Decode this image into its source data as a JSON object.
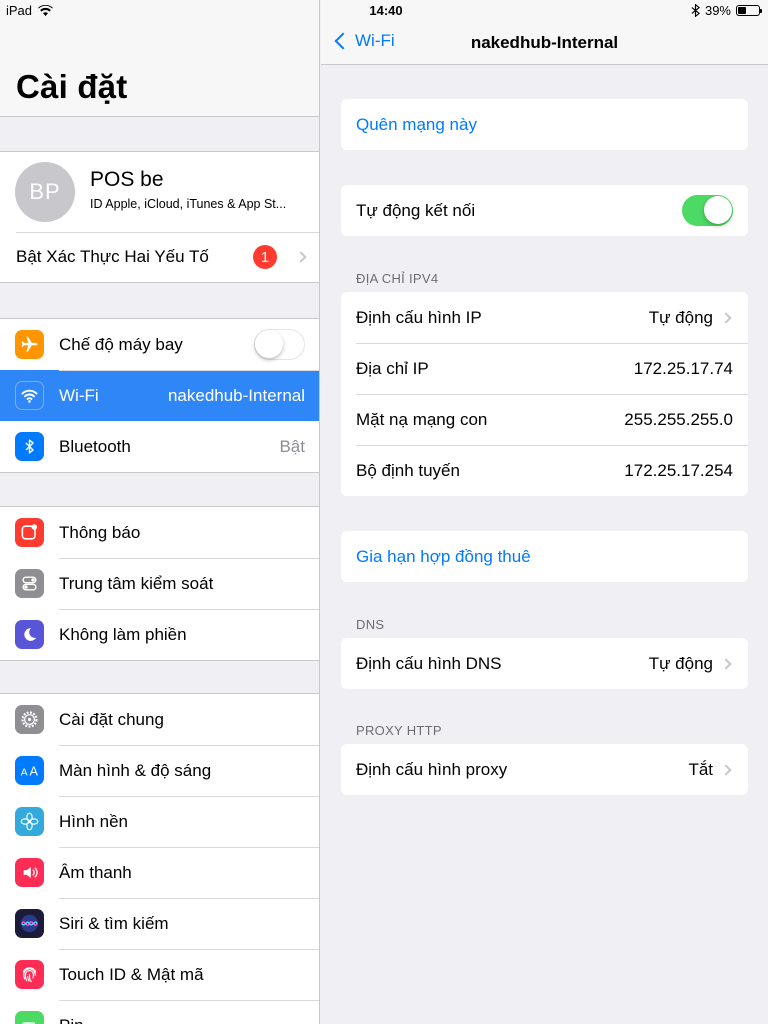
{
  "status_bar": {
    "device": "iPad",
    "time": "14:40",
    "battery": "39%",
    "battery_level": 0.39
  },
  "master": {
    "title": "Cài đặt",
    "profile": {
      "initials": "BP",
      "name": "POS be",
      "subtitle": "ID Apple, iCloud, iTunes & App St..."
    },
    "two_factor": {
      "label": "Bật Xác Thực Hai Yếu Tố",
      "badge": "1"
    },
    "connectivity": [
      {
        "label": "Chế độ máy bay",
        "icon": "airplane-icon",
        "color": "#ff9500",
        "toggle": false
      },
      {
        "label": "Wi-Fi",
        "value": "nakedhub-Internal",
        "icon": "wifi-icon",
        "color": "#007aff"
      },
      {
        "label": "Bluetooth",
        "value": "Bật",
        "icon": "bluetooth-icon",
        "color": "#007aff"
      }
    ],
    "notifications": [
      {
        "label": "Thông báo",
        "icon": "notifications-icon",
        "color": "#ff3b30"
      },
      {
        "label": "Trung tâm kiểm soát",
        "icon": "control-center-icon",
        "color": "#8e8e93"
      },
      {
        "label": "Không làm phiền",
        "icon": "moon-icon",
        "color": "#5856d6"
      }
    ],
    "general": [
      {
        "label": "Cài đặt chung",
        "icon": "gear-icon",
        "color": "#8e8e93"
      },
      {
        "label": "Màn hình & độ sáng",
        "icon": "display-icon",
        "color": "#007aff"
      },
      {
        "label": "Hình nền",
        "icon": "wallpaper-icon",
        "color": "#34aadc"
      },
      {
        "label": "Âm thanh",
        "icon": "speaker-icon",
        "color": "#ff2d55"
      },
      {
        "label": "Siri & tìm kiếm",
        "icon": "siri-icon",
        "color": "#1c1c3a"
      },
      {
        "label": "Touch ID & Mật mã",
        "icon": "fingerprint-icon",
        "color": "#ff2d55"
      },
      {
        "label": "Pin",
        "icon": "battery-icon",
        "color": "#4cd964"
      }
    ]
  },
  "detail": {
    "back_label": "Wi-Fi",
    "title": "nakedhub-Internal",
    "forget": "Quên mạng này",
    "auto_join": {
      "label": "Tự động kết nối",
      "on": true
    },
    "ipv4_header": "ĐỊA CHỈ IPV4",
    "ipv4": [
      {
        "label": "Định cấu hình IP",
        "value": "Tự động",
        "chevron": true
      },
      {
        "label": "Địa chỉ IP",
        "value": "172.25.17.74"
      },
      {
        "label": "Mặt nạ mạng con",
        "value": "255.255.255.0"
      },
      {
        "label": "Bộ định tuyến",
        "value": "172.25.17.254"
      }
    ],
    "renew": "Gia hạn hợp đồng thuê",
    "dns_header": "DNS",
    "dns": {
      "label": "Định cấu hình DNS",
      "value": "Tự động"
    },
    "proxy_header": "PROXY HTTP",
    "proxy": {
      "label": "Định cấu hình proxy",
      "value": "Tắt"
    }
  }
}
